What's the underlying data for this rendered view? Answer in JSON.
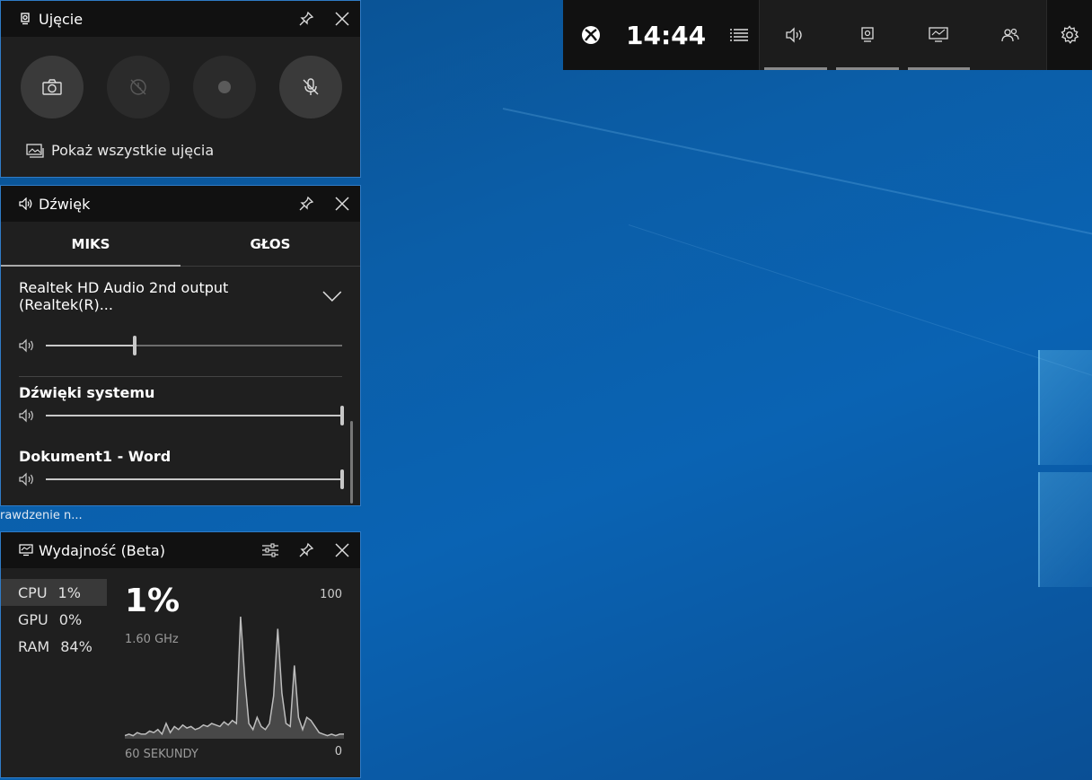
{
  "capture": {
    "title": "Ujęcie",
    "show_all": "Pokaż wszystkie ujęcia"
  },
  "audio": {
    "title": "Dźwięk",
    "tabs": [
      "MIKS",
      "GŁOS"
    ],
    "device": "Realtek HD Audio 2nd output (Realtek(R)...",
    "master_volume": 0.3,
    "apps": [
      {
        "name": "Dźwięki systemu",
        "volume": 1.0
      },
      {
        "name": "Dokument1 - Word",
        "volume": 1.0
      }
    ]
  },
  "tooltip": "rawdzenie n...",
  "performance": {
    "title": "Wydajność (Beta)",
    "metrics": [
      {
        "label": "CPU",
        "value": "1%"
      },
      {
        "label": "GPU",
        "value": "0%"
      },
      {
        "label": "RAM",
        "value": "84%"
      }
    ],
    "big_value": "1%",
    "frequency": "1.60 GHz",
    "y_max": "100",
    "y_min": "0",
    "x_label": "60 SEKUNDY",
    "chart_data": {
      "type": "area",
      "ylim": [
        0,
        100
      ],
      "values": [
        2,
        3,
        2,
        4,
        3,
        3,
        5,
        4,
        6,
        3,
        10,
        4,
        8,
        6,
        9,
        7,
        8,
        6,
        7,
        9,
        8,
        10,
        9,
        8,
        11,
        9,
        12,
        10,
        80,
        40,
        10,
        6,
        14,
        8,
        6,
        10,
        28,
        72,
        30,
        10,
        8,
        48,
        14,
        6,
        14,
        12,
        8,
        4,
        3,
        2,
        3,
        2,
        3,
        3
      ]
    }
  },
  "topbar": {
    "time": "14:44"
  }
}
